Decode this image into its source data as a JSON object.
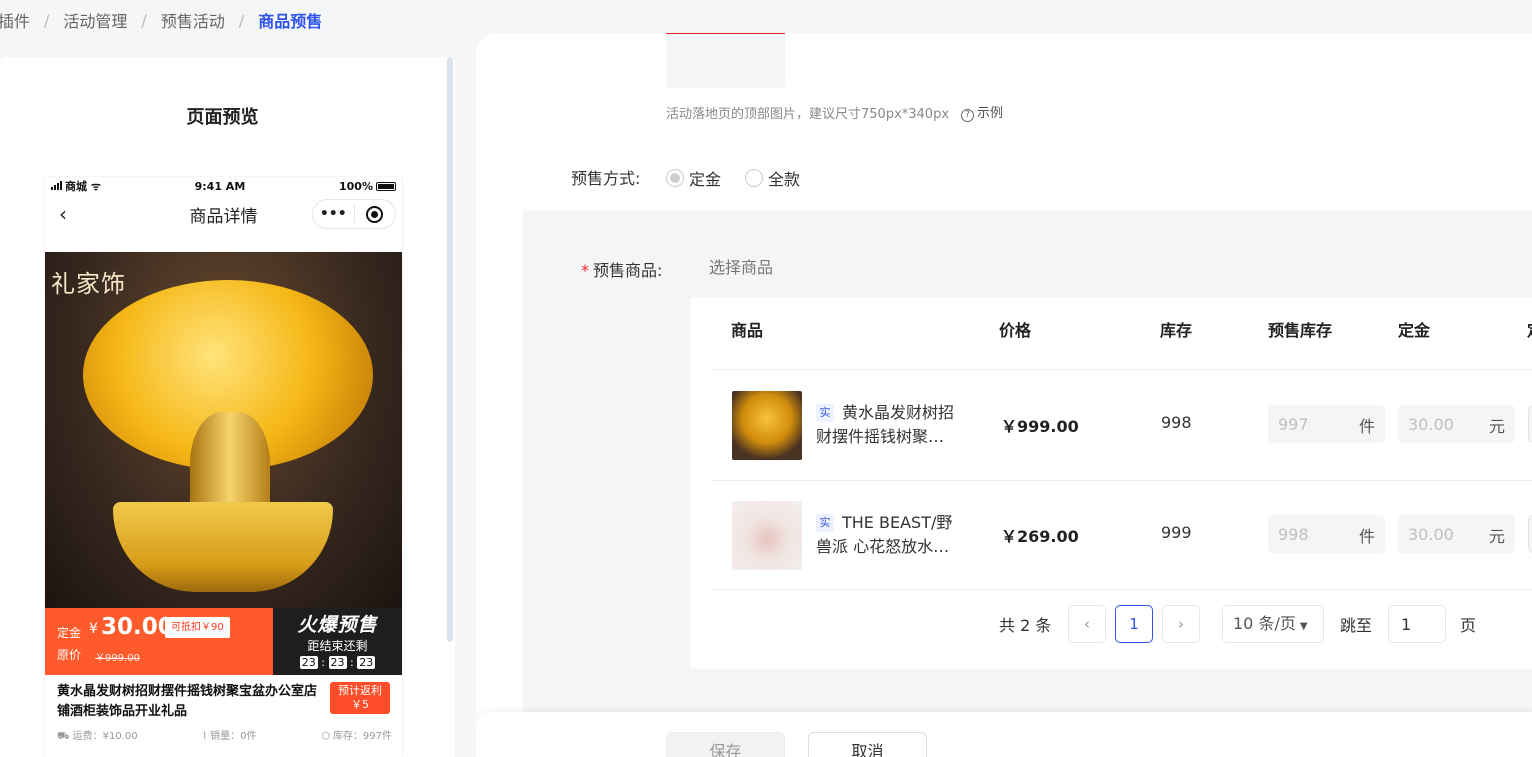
{
  "breadcrumb": [
    "插件",
    "活动管理",
    "预售活动",
    "商品预售"
  ],
  "preview": {
    "title": "页面预览",
    "statusbar": {
      "carrier": "商城",
      "time": "9:41 AM",
      "battery": "100%"
    },
    "navbar_title": "商品详情",
    "image_brand": "礼家饰",
    "promo": {
      "deposit_label": "定金",
      "currency": "¥",
      "deposit_amount": "30.00",
      "deduct_tag": "可抵扣￥90",
      "orig_label": "原价",
      "orig_price": "￥999.00",
      "hot_title": "火爆预售",
      "countdown_label": "距结束还剩",
      "countdown": [
        "23",
        "23",
        "23"
      ]
    },
    "item_title": "黄水晶发财树招财摆件摇钱树聚宝盆办公室店铺酒柜装饰品开业礼品",
    "rebate_label": "预计返利",
    "rebate_value": "￥5",
    "meta": {
      "freight": "运费：¥10.00",
      "sales": "销量：0件",
      "stock": "库存：997件"
    }
  },
  "form": {
    "cover_hint": "活动落地页的顶部图片，建议尺寸750px*340px",
    "cover_example": "示例",
    "presale_type_label": "预售方式:",
    "presale_options": [
      {
        "label": "定金",
        "checked": true
      },
      {
        "label": "全款",
        "checked": false
      }
    ],
    "goods_required": "*",
    "goods_label": "预售商品:",
    "select_goods": "选择商品",
    "table": {
      "headers": [
        "商品",
        "价格",
        "库存",
        "预售库存",
        "定金",
        "定"
      ],
      "rows": [
        {
          "tag": "实",
          "name": "黄水晶发财树招财摆件摇钱树聚…",
          "price": "￥999.00",
          "stock": "998",
          "presale_stock_placeholder": "997",
          "stock_unit": "件",
          "deposit_placeholder": "30.00",
          "deposit_unit": "元"
        },
        {
          "tag": "实",
          "name": "THE BEAST/野兽派 心花怒放水…",
          "price": "￥269.00",
          "stock": "999",
          "presale_stock_placeholder": "998",
          "stock_unit": "件",
          "deposit_placeholder": "30.00",
          "deposit_unit": "元"
        }
      ]
    },
    "pager": {
      "total": "共 2 条",
      "current": "1",
      "page_size": "10 条/页",
      "jump_label": "跳至",
      "jump_value": "1",
      "page_suffix": "页"
    },
    "buttons": {
      "save": "保存",
      "cancel": "取消"
    }
  }
}
